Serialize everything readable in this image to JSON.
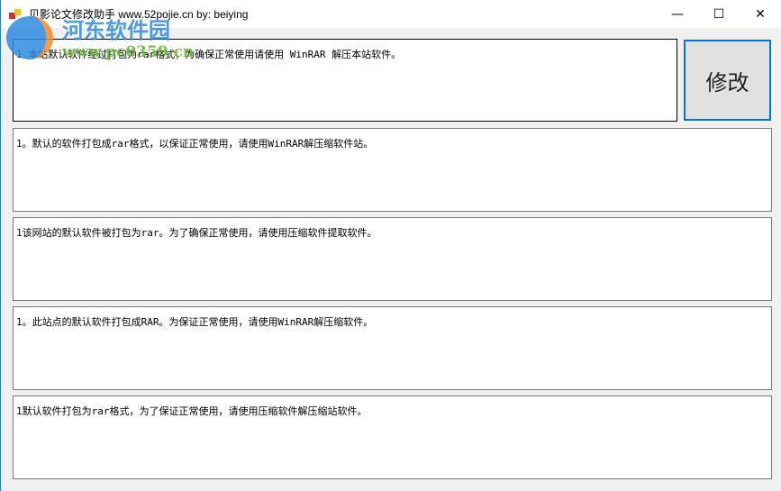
{
  "window": {
    "title": "贝影论文修改助手 www.52pojie.cn by: beiying",
    "minimize": "—",
    "maximize": "☐",
    "close": "✕"
  },
  "watermark": {
    "name": "河东软件园",
    "url": "www.pc0359.cn"
  },
  "main": {
    "input_text": "1.本站默认软件经过打包为rar格式，为确保正常使用请使用 WinRAR 解压本站软件。",
    "modify_button": "修改",
    "outputs": [
      "1。默认的软件打包成rar格式，以保证正常使用，请使用WinRAR解压缩软件站。",
      "1该网站的默认软件被打包为rar。为了确保正常使用，请使用压缩软件提取软件。",
      "1。此站点的默认软件打包成RAR。为保证正常使用，请使用WinRAR解压缩软件。",
      "1默认软件打包为rar格式，为了保证正常使用，请使用压缩软件解压缩站软件。"
    ]
  }
}
